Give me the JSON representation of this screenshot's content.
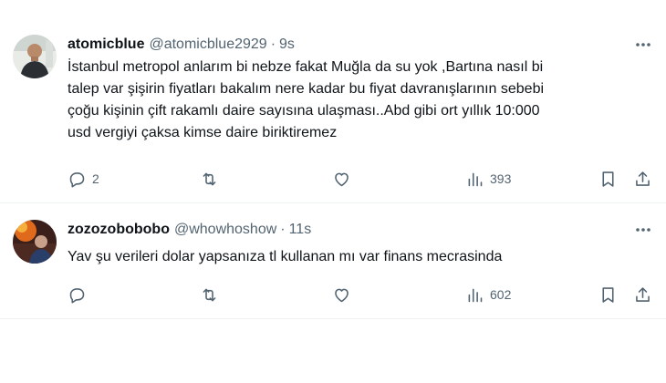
{
  "tweets": [
    {
      "display_name": "atomicblue",
      "handle": "@atomicblue2929",
      "separator": "·",
      "time": "9s",
      "text": "İstanbul metropol anlarım bi nebze fakat Muğla da su yok ,Bartına nasıl bi\ntalep var şişirin fiyatları bakalım nere kadar bu fiyat davranışlarının sebebi\nçoğu kişinin çift rakamlı daire sayısına ulaşması..Abd gibi ort yıllık 10:000\nusd vergiyi çaksa kimse daire biriktiremez",
      "replies": "2",
      "retweets": "",
      "likes": "",
      "views": "393"
    },
    {
      "display_name": "zozozobobobo",
      "handle": "@whowhoshow",
      "separator": "·",
      "time": "11s",
      "text": "Yav şu verileri dolar yapsanıza tl kullanan mı var finans mecrasinda",
      "replies": "",
      "retweets": "",
      "likes": "",
      "views": "602"
    }
  ],
  "icons": {
    "more": "more-horizontal-icon",
    "reply": "reply-icon",
    "retweet": "retweet-icon",
    "like": "heart-icon",
    "views": "views-icon",
    "bookmark": "bookmark-icon",
    "share": "share-icon"
  },
  "colors": {
    "text_primary": "#0f1419",
    "text_secondary": "#536471",
    "divider": "#eff3f4"
  }
}
